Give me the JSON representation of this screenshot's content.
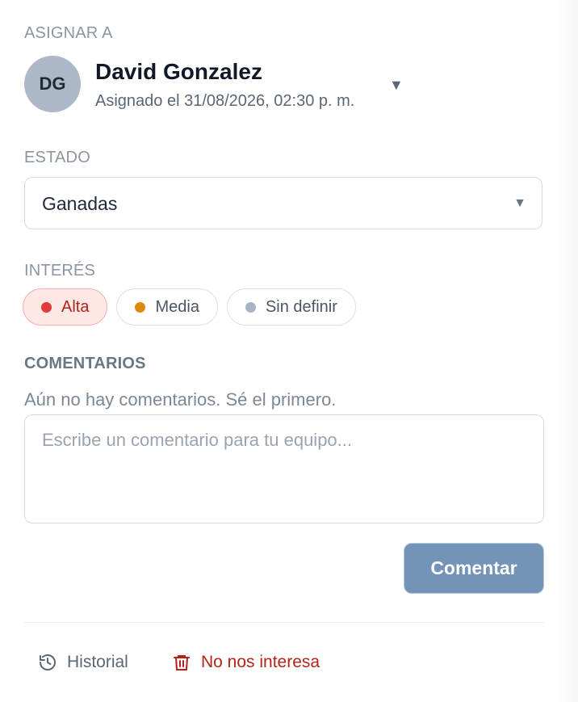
{
  "assign": {
    "label": "ASIGNAR A",
    "avatar_initials": "DG",
    "name": "David Gonzalez",
    "assigned_text": "Asignado el 31/08/2026, 02:30 p. m.",
    "caret": "▼"
  },
  "status": {
    "label": "ESTADO",
    "value": "Ganadas",
    "caret": "▼"
  },
  "interest": {
    "label": "INTERÉS",
    "options": [
      {
        "label": "Alta",
        "color": "#e03a3a",
        "selected": true
      },
      {
        "label": "Media",
        "color": "#e08a0b",
        "selected": false
      },
      {
        "label": "Sin definir",
        "color": "#a9b4c2",
        "selected": false
      }
    ]
  },
  "comments": {
    "label": "COMENTARIOS",
    "empty_text": "Aún no hay comentarios. Sé el primero.",
    "placeholder": "Escribe un comentario para tu equipo...",
    "submit_label": "Comentar"
  },
  "footer": {
    "history_label": "Historial",
    "history_icon": "history-icon",
    "discard_label": "No nos interesa",
    "discard_icon": "trash-icon"
  }
}
